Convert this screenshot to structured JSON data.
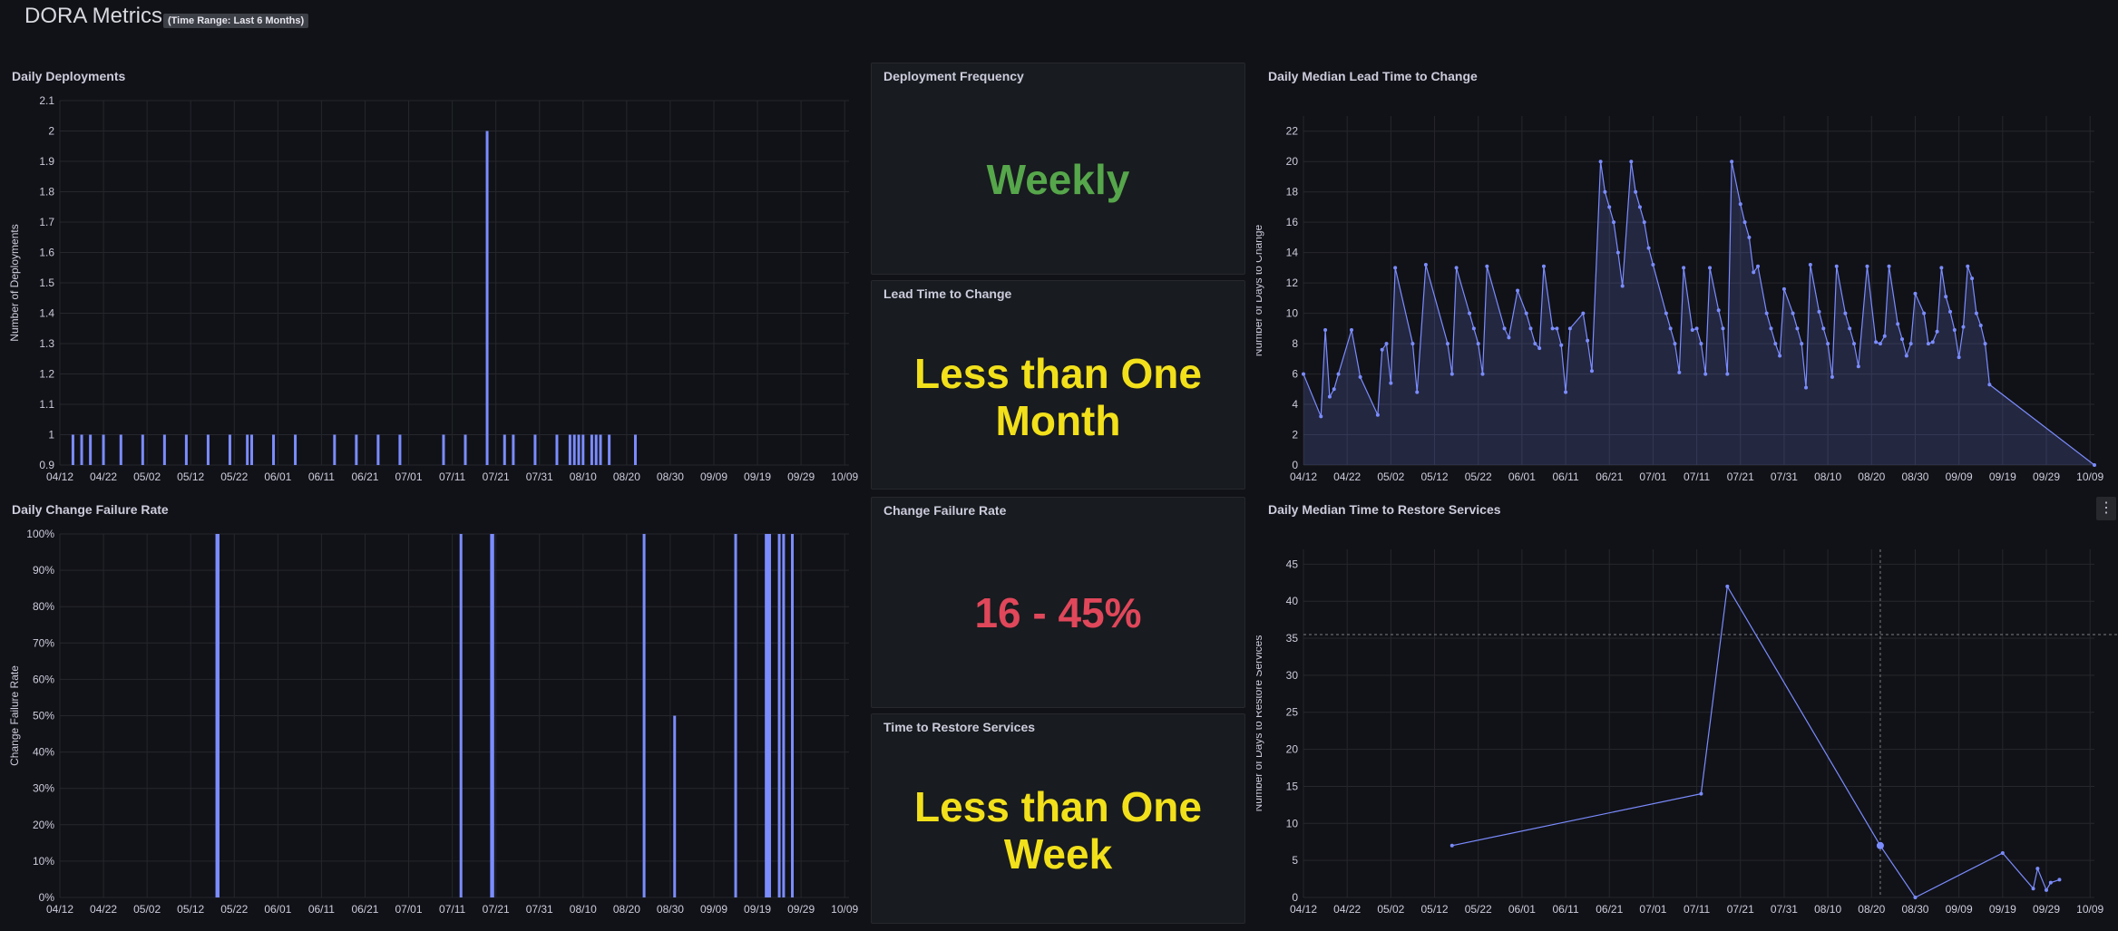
{
  "dashboard": {
    "title": "DORA Metrics",
    "badge": "(Time Range: Last 6 Months)"
  },
  "colors": {
    "series": "#7b8cff",
    "grid": "#25272d",
    "axis_text": "#ccccdc",
    "green": "#56a64b",
    "yellow": "#f2e01b",
    "red": "#e0475a"
  },
  "x_ticks": [
    "04/12",
    "04/22",
    "05/02",
    "05/12",
    "05/22",
    "06/01",
    "06/11",
    "06/21",
    "07/01",
    "07/11",
    "07/21",
    "07/31",
    "08/10",
    "08/20",
    "08/30",
    "09/09",
    "09/19",
    "09/29",
    "10/09"
  ],
  "panels": {
    "deploy_freq": {
      "title": "Deployment Frequency",
      "value": "Weekly"
    },
    "lead_time": {
      "title": "Lead Time to Change",
      "value_line1": "Less than One",
      "value_line2": "Month"
    },
    "cfr": {
      "title": "Change Failure Rate",
      "value": "16 - 45%"
    },
    "ttr": {
      "title": "Time to Restore Services",
      "value_line1": "Less than One",
      "value_line2": "Week"
    }
  },
  "chart_data": [
    {
      "id": "deployments",
      "title": "Daily Deployments",
      "type": "bar",
      "ylabel": "Number of Deployments",
      "ylim": [
        0.9,
        2.1
      ],
      "yticks": [
        0.9,
        1,
        1.1,
        1.2,
        1.3,
        1.4,
        1.5,
        1.6,
        1.7,
        1.8,
        1.9,
        2,
        2.1
      ],
      "x_start": "2024-04-12",
      "x_ticks_days": [
        0,
        10,
        20,
        30,
        40,
        50,
        60,
        70,
        80,
        90,
        100,
        110,
        120,
        130,
        140,
        150,
        160,
        170,
        180
      ],
      "points": [
        [
          3,
          1
        ],
        [
          5,
          1
        ],
        [
          7,
          1
        ],
        [
          10,
          1
        ],
        [
          14,
          1
        ],
        [
          19,
          1
        ],
        [
          24,
          1
        ],
        [
          29,
          1
        ],
        [
          34,
          1
        ],
        [
          39,
          1
        ],
        [
          43,
          1
        ],
        [
          44,
          1
        ],
        [
          49,
          1
        ],
        [
          54,
          1
        ],
        [
          63,
          1
        ],
        [
          68,
          1
        ],
        [
          73,
          1
        ],
        [
          78,
          1
        ],
        [
          88,
          1
        ],
        [
          93,
          1
        ],
        [
          98,
          2
        ],
        [
          102,
          1
        ],
        [
          104,
          1
        ],
        [
          109,
          1
        ],
        [
          114,
          1
        ],
        [
          117,
          1
        ],
        [
          118,
          1
        ],
        [
          119,
          1
        ],
        [
          120,
          1
        ],
        [
          122,
          1
        ],
        [
          123,
          1
        ],
        [
          124,
          1
        ],
        [
          126,
          1
        ],
        [
          132,
          1
        ]
      ]
    },
    {
      "id": "cfr_chart",
      "title": "Daily Change Failure Rate",
      "type": "bar",
      "ylabel": "Change Failure Rate",
      "ylim": [
        0,
        100
      ],
      "yticks": [
        0,
        10,
        20,
        30,
        40,
        50,
        60,
        70,
        80,
        90,
        100
      ],
      "yunit": "%",
      "x_start": "2024-04-12",
      "x_ticks_days": [
        0,
        10,
        20,
        30,
        40,
        50,
        60,
        70,
        80,
        90,
        100,
        110,
        120,
        130,
        140,
        150,
        160,
        170,
        180
      ],
      "points": [
        [
          36,
          100
        ],
        [
          36.3,
          100
        ],
        [
          92,
          100
        ],
        [
          99,
          100
        ],
        [
          99.3,
          100
        ],
        [
          134,
          100
        ],
        [
          141,
          50
        ],
        [
          155,
          100
        ],
        [
          162,
          100
        ],
        [
          162.4,
          100
        ],
        [
          162.8,
          100
        ],
        [
          165,
          100
        ],
        [
          166,
          100
        ],
        [
          168,
          100
        ]
      ]
    },
    {
      "id": "lead_time_chart",
      "title": "Daily Median Lead Time to Change",
      "type": "area",
      "ylabel": "Number of Days to Change",
      "ylim": [
        0,
        23
      ],
      "yticks": [
        0,
        2,
        4,
        6,
        8,
        10,
        12,
        14,
        16,
        18,
        20,
        22
      ],
      "x_start": "2024-04-12",
      "x_ticks_days": [
        0,
        10,
        20,
        30,
        40,
        50,
        60,
        70,
        80,
        90,
        100,
        110,
        120,
        130,
        140,
        150,
        160,
        170,
        180
      ],
      "points": [
        [
          0,
          6
        ],
        [
          4,
          3.2
        ],
        [
          5,
          8.9
        ],
        [
          6,
          4.5
        ],
        [
          7,
          5
        ],
        [
          8,
          6
        ],
        [
          11,
          8.9
        ],
        [
          13,
          5.8
        ],
        [
          17,
          3.3
        ],
        [
          18,
          7.6
        ],
        [
          19,
          8
        ],
        [
          20,
          5.4
        ],
        [
          21,
          13
        ],
        [
          25,
          8
        ],
        [
          26,
          4.8
        ],
        [
          28,
          13.2
        ],
        [
          33,
          8
        ],
        [
          34,
          6
        ],
        [
          35,
          13
        ],
        [
          38,
          10
        ],
        [
          39,
          9
        ],
        [
          40,
          8
        ],
        [
          41,
          6
        ],
        [
          42,
          13.1
        ],
        [
          46,
          9
        ],
        [
          47,
          8.4
        ],
        [
          49,
          11.5
        ],
        [
          51,
          10
        ],
        [
          52,
          9
        ],
        [
          53,
          8
        ],
        [
          54,
          7.7
        ],
        [
          55,
          13.1
        ],
        [
          57,
          9
        ],
        [
          58,
          9
        ],
        [
          59,
          7.9
        ],
        [
          60,
          4.8
        ],
        [
          61,
          9
        ],
        [
          64,
          10
        ],
        [
          65,
          8.2
        ],
        [
          66,
          6.2
        ],
        [
          68,
          20
        ],
        [
          69,
          18
        ],
        [
          70,
          17
        ],
        [
          71,
          16
        ],
        [
          72,
          14
        ],
        [
          73,
          11.8
        ],
        [
          75,
          20
        ],
        [
          76,
          18
        ],
        [
          77,
          17
        ],
        [
          78,
          16
        ],
        [
          79,
          14.3
        ],
        [
          80,
          13.2
        ],
        [
          83,
          10
        ],
        [
          84,
          9
        ],
        [
          85,
          8
        ],
        [
          86,
          6.1
        ],
        [
          87,
          13
        ],
        [
          89,
          8.9
        ],
        [
          90,
          9
        ],
        [
          91,
          8
        ],
        [
          92,
          6
        ],
        [
          93,
          13
        ],
        [
          95,
          10.2
        ],
        [
          96,
          9
        ],
        [
          97,
          6
        ],
        [
          98,
          20
        ],
        [
          100,
          17.2
        ],
        [
          101,
          16
        ],
        [
          102,
          15
        ],
        [
          103,
          12.7
        ],
        [
          104,
          13.1
        ],
        [
          106,
          10
        ],
        [
          107,
          9
        ],
        [
          108,
          8
        ],
        [
          109,
          7.2
        ],
        [
          110,
          11.6
        ],
        [
          112,
          10
        ],
        [
          113,
          9
        ],
        [
          114,
          8
        ],
        [
          115,
          5.1
        ],
        [
          116,
          13.2
        ],
        [
          118,
          10.1
        ],
        [
          119,
          9
        ],
        [
          120,
          8
        ],
        [
          121,
          5.8
        ],
        [
          122,
          13.1
        ],
        [
          124,
          10
        ],
        [
          125,
          9
        ],
        [
          126,
          8
        ],
        [
          127,
          6.5
        ],
        [
          129,
          13.1
        ],
        [
          131,
          8.1
        ],
        [
          132,
          8
        ],
        [
          133,
          8.5
        ],
        [
          134,
          13.1
        ],
        [
          136,
          9.3
        ],
        [
          137,
          8.3
        ],
        [
          138,
          7.2
        ],
        [
          139,
          8
        ],
        [
          140,
          11.3
        ],
        [
          142,
          10
        ],
        [
          143,
          8
        ],
        [
          144,
          8.1
        ],
        [
          145,
          8.8
        ],
        [
          146,
          13
        ],
        [
          147,
          11.1
        ],
        [
          148,
          10.1
        ],
        [
          149,
          8.9
        ],
        [
          150,
          7.1
        ],
        [
          151,
          9.1
        ],
        [
          152,
          13.1
        ],
        [
          153,
          12.3
        ],
        [
          154,
          10
        ],
        [
          155,
          9.2
        ],
        [
          156,
          8
        ],
        [
          157,
          5.3
        ],
        [
          181,
          0
        ]
      ]
    },
    {
      "id": "ttr_chart",
      "title": "Daily Median Time to Restore Services",
      "type": "line",
      "ylabel": "Number of Days to Restore Services",
      "ylim": [
        0,
        47
      ],
      "yticks": [
        0,
        5,
        10,
        15,
        20,
        25,
        30,
        35,
        40,
        45
      ],
      "x_start": "2024-04-12",
      "x_ticks_days": [
        0,
        10,
        20,
        30,
        40,
        50,
        60,
        70,
        80,
        90,
        100,
        110,
        120,
        130,
        140,
        150,
        160,
        170,
        180
      ],
      "points": [
        [
          34,
          7
        ],
        [
          91,
          14
        ],
        [
          97,
          42
        ],
        [
          132,
          7
        ],
        [
          140,
          0
        ],
        [
          160,
          6
        ],
        [
          167,
          1.2
        ],
        [
          168,
          3.9
        ],
        [
          170,
          1
        ],
        [
          171,
          2
        ],
        [
          173,
          2.4
        ]
      ],
      "highlight_index": 3,
      "crosshair_y": 35.5
    }
  ]
}
